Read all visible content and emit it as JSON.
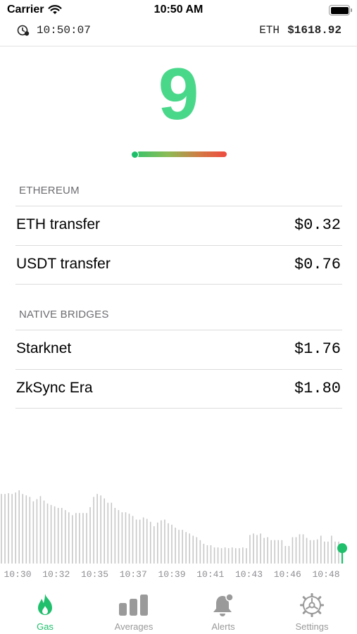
{
  "status_bar": {
    "carrier": "Carrier",
    "time": "10:50 AM"
  },
  "info_bar": {
    "clock": "10:50:07",
    "eth_label": "ETH",
    "eth_price": "$1618.92"
  },
  "gas": {
    "value": "9",
    "gauge_level": 0.04
  },
  "sections": [
    {
      "header": "ETHEREUM",
      "rows": [
        {
          "label": "ETH transfer",
          "value": "$0.32"
        },
        {
          "label": "USDT transfer",
          "value": "$0.76"
        }
      ]
    },
    {
      "header": "NATIVE BRIDGES",
      "rows": [
        {
          "label": "Starknet",
          "value": "$1.76"
        },
        {
          "label": "ZkSync Era",
          "value": "$1.80"
        }
      ]
    }
  ],
  "chart_data": {
    "type": "bar",
    "x_tick_labels": [
      "10:30",
      "10:32",
      "10:35",
      "10:37",
      "10:39",
      "10:41",
      "10:43",
      "10:46",
      "10:48"
    ],
    "values": [
      95,
      95,
      96,
      95,
      97,
      100,
      95,
      93,
      91,
      85,
      88,
      92,
      86,
      82,
      80,
      78,
      76,
      76,
      73,
      70,
      66,
      69,
      69,
      69,
      69,
      77,
      91,
      95,
      93,
      89,
      83,
      83,
      76,
      73,
      70,
      70,
      68,
      65,
      60,
      60,
      63,
      61,
      57,
      51,
      56,
      59,
      60,
      55,
      53,
      49,
      46,
      46,
      43,
      41,
      38,
      36,
      32,
      27,
      25,
      25,
      22,
      22,
      21,
      22,
      21,
      22,
      21,
      21,
      22,
      21,
      39,
      41,
      39,
      41,
      35,
      36,
      32,
      32,
      32,
      32,
      24,
      24,
      36,
      36,
      40,
      40,
      35,
      32,
      32,
      33,
      38,
      30,
      30,
      38,
      30,
      30,
      21
    ],
    "highlight_last": true,
    "bar_color": "#c7c7c7",
    "highlight_color": "#1fbf6c"
  },
  "tabs": [
    {
      "label": "Gas",
      "icon": "flame-icon",
      "active": true
    },
    {
      "label": "Averages",
      "icon": "bar-chart-icon",
      "active": false
    },
    {
      "label": "Alerts",
      "icon": "bell-icon",
      "active": false
    },
    {
      "label": "Settings",
      "icon": "gear-icon",
      "active": false
    }
  ],
  "colors": {
    "accent": "#1fbf6c",
    "gas_number": "#49d88a",
    "gauge_start": "#3cc46a",
    "gauge_end": "#ef4a3f"
  }
}
